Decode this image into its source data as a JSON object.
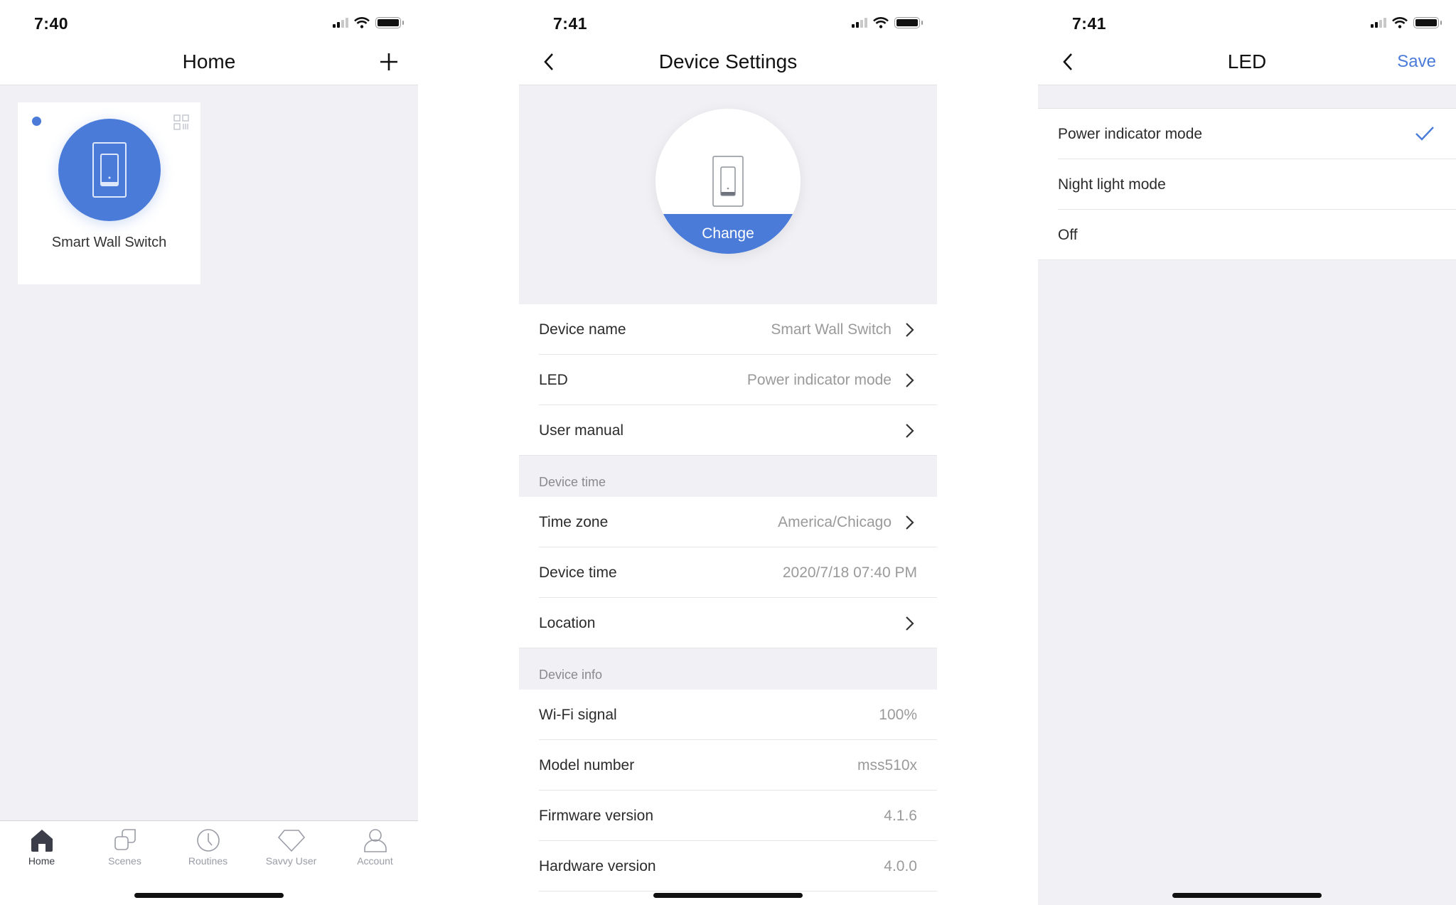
{
  "screens": {
    "home": {
      "status_time": "7:40",
      "title": "Home",
      "add_icon": "plus-icon",
      "device_card": {
        "name": "Smart Wall Switch",
        "online": true,
        "icon": "wall-switch-icon",
        "corner_icon": "qr-code-icon"
      },
      "tabs": [
        {
          "label": "Home",
          "icon": "house-icon",
          "active": true
        },
        {
          "label": "Scenes",
          "icon": "scenes-icon",
          "active": false
        },
        {
          "label": "Routines",
          "icon": "clock-icon",
          "active": false
        },
        {
          "label": "Savvy User",
          "icon": "diamond-icon",
          "active": false
        },
        {
          "label": "Account",
          "icon": "person-icon",
          "active": false
        }
      ]
    },
    "device_settings": {
      "status_time": "7:41",
      "title": "Device Settings",
      "change_label": "Change",
      "rows_main": [
        {
          "label": "Device name",
          "value": "Smart Wall Switch",
          "chevron": true
        },
        {
          "label": "LED",
          "value": "Power indicator mode",
          "chevron": true
        },
        {
          "label": "User manual",
          "value": "",
          "chevron": true
        }
      ],
      "section_time": "Device time",
      "rows_time": [
        {
          "label": "Time zone",
          "value": "America/Chicago",
          "chevron": true
        },
        {
          "label": "Device time",
          "value": "2020/7/18 07:40 PM",
          "chevron": false
        },
        {
          "label": "Location",
          "value": "",
          "chevron": true
        }
      ],
      "section_info": "Device info",
      "rows_info": [
        {
          "label": "Wi-Fi signal",
          "value": "100%",
          "chevron": false
        },
        {
          "label": "Model number",
          "value": "mss510x",
          "chevron": false
        },
        {
          "label": "Firmware version",
          "value": "4.1.6",
          "chevron": false
        },
        {
          "label": "Hardware version",
          "value": "4.0.0",
          "chevron": false
        }
      ]
    },
    "led": {
      "status_time": "7:41",
      "title": "LED",
      "save_label": "Save",
      "options": [
        {
          "label": "Power indicator mode",
          "selected": true
        },
        {
          "label": "Night light mode",
          "selected": false
        },
        {
          "label": "Off",
          "selected": false
        }
      ]
    }
  },
  "colors": {
    "accent": "#4a7bd9",
    "background_gray": "#f1f1f5",
    "value_gray": "#9a9a9a"
  }
}
